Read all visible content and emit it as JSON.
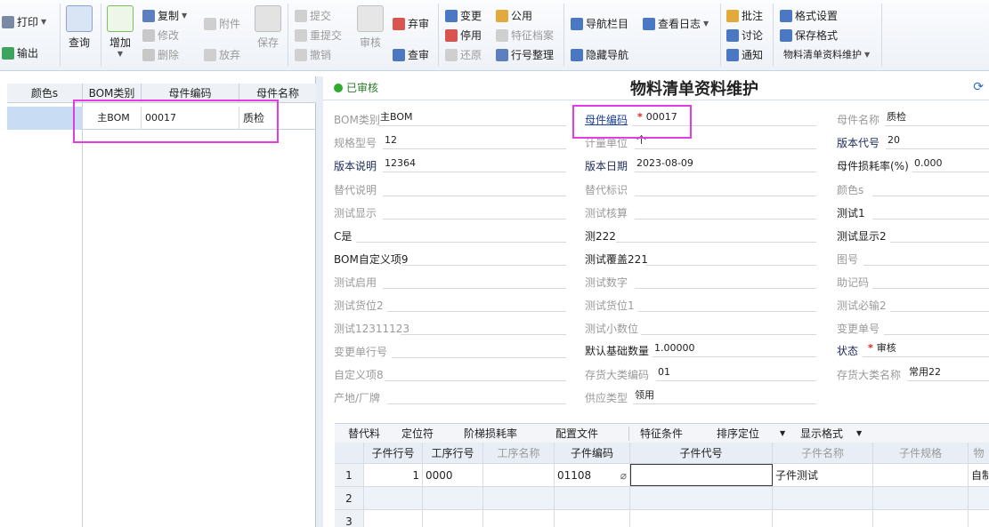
{
  "toolbar": {
    "print": "打印",
    "export": "输出",
    "query": "查询",
    "add": "增加",
    "copy": "复制",
    "modify": "修改",
    "delete": "删除",
    "attach": "附件",
    "discard": "放弃",
    "save": "保存",
    "submit": "提交",
    "resubmit": "重提交",
    "withdraw": "撤销",
    "audit": "审核",
    "abandon_audit": "弃审",
    "check_audit": "查审",
    "change": "变更",
    "stop": "停用",
    "restore": "还原",
    "common": "公用",
    "feature_file": "特征档案",
    "row_organize": "行号整理",
    "nav_bar": "导航栏目",
    "view_log": "查看日志",
    "hide_nav": "隐藏导航",
    "annotate": "批注",
    "discuss": "讨论",
    "notify": "通知",
    "format_settings": "格式设置",
    "save_format": "保存格式",
    "form_menu": "物料清单资料维护"
  },
  "left_grid": {
    "headers": [
      "颜色s",
      "BOM类别",
      "母件编码",
      "母件名称"
    ],
    "row": {
      "color": "",
      "bom_type": "主BOM",
      "parent_code": "00017",
      "parent_name": "质检"
    }
  },
  "status": "已审核",
  "title": "物料清单资料维护",
  "fields": {
    "bom_type": {
      "label": "BOM类别",
      "value": "主BOM"
    },
    "parent_code": {
      "label": "母件编码",
      "value": "00017"
    },
    "parent_name": {
      "label": "母件名称",
      "value": "质检"
    },
    "spec": {
      "label": "规格型号",
      "value": "12"
    },
    "unit": {
      "label": "计量单位",
      "value": "个"
    },
    "version_code": {
      "label": "版本代号",
      "value": "20"
    },
    "version_desc": {
      "label": "版本说明",
      "value": "12364"
    },
    "version_date": {
      "label": "版本日期",
      "value": "2023-08-09"
    },
    "loss_rate": {
      "label": "母件损耗率(%)",
      "value": "0.000"
    },
    "alt_desc": {
      "label": "替代说明",
      "value": ""
    },
    "alt_flag": {
      "label": "替代标识",
      "value": ""
    },
    "color_s": {
      "label": "颜色s",
      "value": ""
    },
    "test_display": {
      "label": "测试显示",
      "value": ""
    },
    "test_calc": {
      "label": "测试核算",
      "value": ""
    },
    "test1": {
      "label": "测试1",
      "value": ""
    },
    "c_yes": {
      "label": "C是",
      "value": ""
    },
    "ce222": {
      "label": "测222",
      "value": ""
    },
    "test_display2": {
      "label": "测试显示2",
      "value": ""
    },
    "bom_custom9": {
      "label": "BOM自定义项9",
      "value": ""
    },
    "test_cover221": {
      "label": "测试覆盖221",
      "value": ""
    },
    "drawing_no": {
      "label": "图号",
      "value": ""
    },
    "test_enable": {
      "label": "测试启用",
      "value": ""
    },
    "test_number": {
      "label": "测试数字",
      "value": ""
    },
    "mnemonic": {
      "label": "助记码",
      "value": ""
    },
    "test_slot2": {
      "label": "测试货位2",
      "value": ""
    },
    "test_slot1": {
      "label": "测试货位1",
      "value": ""
    },
    "test_required2": {
      "label": "测试必输2",
      "value": ""
    },
    "test12311123": {
      "label": "测试12311123",
      "value": ""
    },
    "test_decimal": {
      "label": "测试小数位",
      "value": ""
    },
    "change_no": {
      "label": "变更单号",
      "value": ""
    },
    "change_row": {
      "label": "变更单行号",
      "value": ""
    },
    "default_base_qty": {
      "label": "默认基础数量",
      "value": "1.00000"
    },
    "state": {
      "label": "状态",
      "value": "审核"
    },
    "custom8": {
      "label": "自定义项8",
      "value": ""
    },
    "inv_cat_code": {
      "label": "存货大类编码",
      "value": "01"
    },
    "inv_cat_name": {
      "label": "存货大类名称",
      "value": "常用22"
    },
    "origin_brand": {
      "label": "产地/厂牌",
      "value": ""
    },
    "supply_type": {
      "label": "供应类型",
      "value": "领用"
    }
  },
  "grid_toolbar": [
    "替代料",
    "定位符",
    "阶梯损耗率",
    "配置文件",
    "特征条件",
    "排序定位",
    "显示格式"
  ],
  "child_grid": {
    "headers": [
      "",
      "子件行号",
      "工序行号",
      "工序名称",
      "子件编码",
      "子件代号",
      "子件名称",
      "子件规格",
      "物"
    ],
    "rows": [
      {
        "no": "1",
        "line": "1",
        "op_line": "0000",
        "op_name": "",
        "code": "01108",
        "alias": "",
        "name": "子件测试",
        "spec": "",
        "extra": "自制"
      },
      {
        "no": "2"
      },
      {
        "no": "3"
      }
    ]
  },
  "colors": {
    "highlight": "#e33ce3",
    "status_green": "#2faa2f",
    "link_blue": "#1c3f94",
    "required_red": "#e02020"
  }
}
